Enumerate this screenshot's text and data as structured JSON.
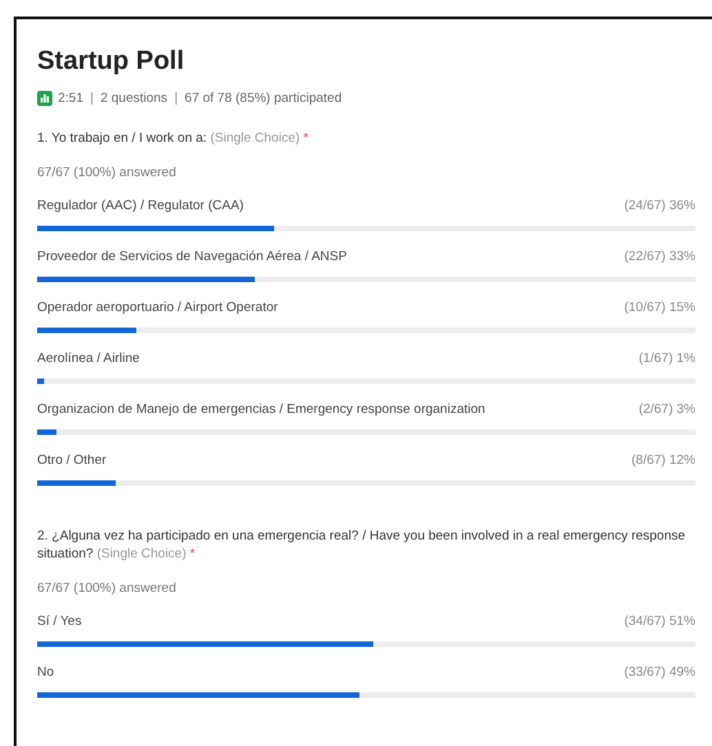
{
  "poll": {
    "title": "Startup Poll",
    "meta": [
      "2:51",
      "2 questions",
      "67 of 78 (85%) participated"
    ],
    "meta_separator": "|"
  },
  "questions": [
    {
      "text": "1. Yo trabajo en / I work on a:",
      "type": "(Single Choice)",
      "required_mark": "*",
      "answered": "67/67 (100%) answered",
      "options": [
        {
          "label": "Regulador (AAC) / Regulator (CAA)",
          "reading": "(24/67) 36%",
          "level": 0.36
        },
        {
          "label": "Proveedor de Servicios de Navegación Aérea / ANSP",
          "reading": "(22/67) 33%",
          "level": 0.33
        },
        {
          "label": "Operador aeroportuario / Airport Operator",
          "reading": "(10/67) 15%",
          "level": 0.15
        },
        {
          "label": "Aerolínea / Airline",
          "reading": "(1/67) 1%",
          "level": 0.01
        },
        {
          "label": "Organizacion de Manejo de emergencias / Emergency response organization",
          "reading": "(2/67) 3%",
          "level": 0.03
        },
        {
          "label": "Otro / Other",
          "reading": "(8/67) 12%",
          "level": 0.12
        }
      ]
    },
    {
      "text": "2. ¿Alguna vez ha participado en una emergencia real? / Have you been involved in a real emergency response situation?",
      "type": "(Single Choice)",
      "required_mark": "*",
      "answered": "67/67 (100%) answered",
      "options": [
        {
          "label": "Sí / Yes",
          "reading": "(34/67) 51%",
          "level": 0.51
        },
        {
          "label": "No",
          "reading": "(33/67) 49%",
          "level": 0.49
        }
      ]
    }
  ]
}
